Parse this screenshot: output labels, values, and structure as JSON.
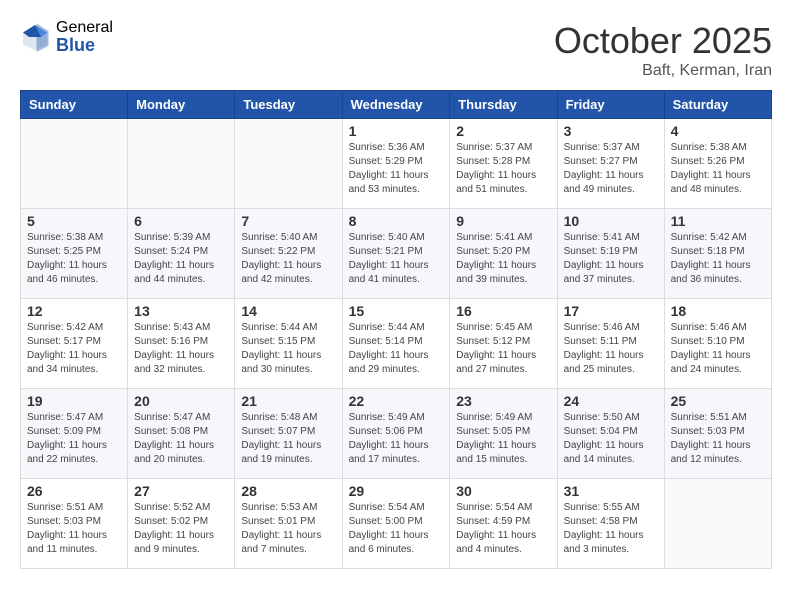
{
  "logo": {
    "general": "General",
    "blue": "Blue"
  },
  "header": {
    "month": "October 2025",
    "location": "Baft, Kerman, Iran"
  },
  "weekdays": [
    "Sunday",
    "Monday",
    "Tuesday",
    "Wednesday",
    "Thursday",
    "Friday",
    "Saturday"
  ],
  "weeks": [
    [
      {
        "day": "",
        "info": ""
      },
      {
        "day": "",
        "info": ""
      },
      {
        "day": "",
        "info": ""
      },
      {
        "day": "1",
        "info": "Sunrise: 5:36 AM\nSunset: 5:29 PM\nDaylight: 11 hours and 53 minutes."
      },
      {
        "day": "2",
        "info": "Sunrise: 5:37 AM\nSunset: 5:28 PM\nDaylight: 11 hours and 51 minutes."
      },
      {
        "day": "3",
        "info": "Sunrise: 5:37 AM\nSunset: 5:27 PM\nDaylight: 11 hours and 49 minutes."
      },
      {
        "day": "4",
        "info": "Sunrise: 5:38 AM\nSunset: 5:26 PM\nDaylight: 11 hours and 48 minutes."
      }
    ],
    [
      {
        "day": "5",
        "info": "Sunrise: 5:38 AM\nSunset: 5:25 PM\nDaylight: 11 hours and 46 minutes."
      },
      {
        "day": "6",
        "info": "Sunrise: 5:39 AM\nSunset: 5:24 PM\nDaylight: 11 hours and 44 minutes."
      },
      {
        "day": "7",
        "info": "Sunrise: 5:40 AM\nSunset: 5:22 PM\nDaylight: 11 hours and 42 minutes."
      },
      {
        "day": "8",
        "info": "Sunrise: 5:40 AM\nSunset: 5:21 PM\nDaylight: 11 hours and 41 minutes."
      },
      {
        "day": "9",
        "info": "Sunrise: 5:41 AM\nSunset: 5:20 PM\nDaylight: 11 hours and 39 minutes."
      },
      {
        "day": "10",
        "info": "Sunrise: 5:41 AM\nSunset: 5:19 PM\nDaylight: 11 hours and 37 minutes."
      },
      {
        "day": "11",
        "info": "Sunrise: 5:42 AM\nSunset: 5:18 PM\nDaylight: 11 hours and 36 minutes."
      }
    ],
    [
      {
        "day": "12",
        "info": "Sunrise: 5:42 AM\nSunset: 5:17 PM\nDaylight: 11 hours and 34 minutes."
      },
      {
        "day": "13",
        "info": "Sunrise: 5:43 AM\nSunset: 5:16 PM\nDaylight: 11 hours and 32 minutes."
      },
      {
        "day": "14",
        "info": "Sunrise: 5:44 AM\nSunset: 5:15 PM\nDaylight: 11 hours and 30 minutes."
      },
      {
        "day": "15",
        "info": "Sunrise: 5:44 AM\nSunset: 5:14 PM\nDaylight: 11 hours and 29 minutes."
      },
      {
        "day": "16",
        "info": "Sunrise: 5:45 AM\nSunset: 5:12 PM\nDaylight: 11 hours and 27 minutes."
      },
      {
        "day": "17",
        "info": "Sunrise: 5:46 AM\nSunset: 5:11 PM\nDaylight: 11 hours and 25 minutes."
      },
      {
        "day": "18",
        "info": "Sunrise: 5:46 AM\nSunset: 5:10 PM\nDaylight: 11 hours and 24 minutes."
      }
    ],
    [
      {
        "day": "19",
        "info": "Sunrise: 5:47 AM\nSunset: 5:09 PM\nDaylight: 11 hours and 22 minutes."
      },
      {
        "day": "20",
        "info": "Sunrise: 5:47 AM\nSunset: 5:08 PM\nDaylight: 11 hours and 20 minutes."
      },
      {
        "day": "21",
        "info": "Sunrise: 5:48 AM\nSunset: 5:07 PM\nDaylight: 11 hours and 19 minutes."
      },
      {
        "day": "22",
        "info": "Sunrise: 5:49 AM\nSunset: 5:06 PM\nDaylight: 11 hours and 17 minutes."
      },
      {
        "day": "23",
        "info": "Sunrise: 5:49 AM\nSunset: 5:05 PM\nDaylight: 11 hours and 15 minutes."
      },
      {
        "day": "24",
        "info": "Sunrise: 5:50 AM\nSunset: 5:04 PM\nDaylight: 11 hours and 14 minutes."
      },
      {
        "day": "25",
        "info": "Sunrise: 5:51 AM\nSunset: 5:03 PM\nDaylight: 11 hours and 12 minutes."
      }
    ],
    [
      {
        "day": "26",
        "info": "Sunrise: 5:51 AM\nSunset: 5:03 PM\nDaylight: 11 hours and 11 minutes."
      },
      {
        "day": "27",
        "info": "Sunrise: 5:52 AM\nSunset: 5:02 PM\nDaylight: 11 hours and 9 minutes."
      },
      {
        "day": "28",
        "info": "Sunrise: 5:53 AM\nSunset: 5:01 PM\nDaylight: 11 hours and 7 minutes."
      },
      {
        "day": "29",
        "info": "Sunrise: 5:54 AM\nSunset: 5:00 PM\nDaylight: 11 hours and 6 minutes."
      },
      {
        "day": "30",
        "info": "Sunrise: 5:54 AM\nSunset: 4:59 PM\nDaylight: 11 hours and 4 minutes."
      },
      {
        "day": "31",
        "info": "Sunrise: 5:55 AM\nSunset: 4:58 PM\nDaylight: 11 hours and 3 minutes."
      },
      {
        "day": "",
        "info": ""
      }
    ]
  ]
}
